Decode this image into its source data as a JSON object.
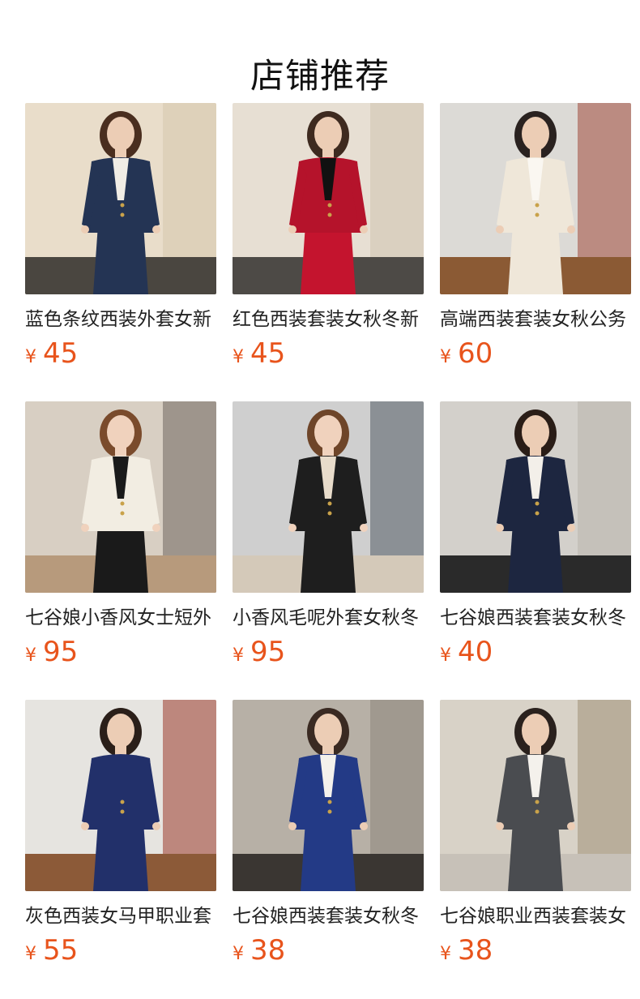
{
  "header": {
    "title": "店铺推荐"
  },
  "products": [
    {
      "name": "蓝色条纹西装外套女新",
      "currency": "¥",
      "price": "45",
      "colors": {
        "bg": "#e9ddca",
        "bgAccent": "#d6c6ad",
        "floor": "#4a4640",
        "jacket": "#243454",
        "inner": "#f1ede6",
        "bottom": "#243454",
        "hair": "#4a2e1f",
        "skin": "#eccdb5"
      }
    },
    {
      "name": "红色西装套装女秋冬新",
      "currency": "¥",
      "price": "45",
      "colors": {
        "bg": "#e7dfd3",
        "bgAccent": "#cfc3b0",
        "floor": "#4d4a46",
        "jacket": "#b5132b",
        "inner": "#111111",
        "bottom": "#c4142e",
        "hair": "#3e2a1f",
        "skin": "#eccdb5"
      }
    },
    {
      "name": "高端西装套装女秋公务",
      "currency": "¥",
      "price": "60",
      "colors": {
        "bg": "#dcdad6",
        "bgAccent": "#a04b3c",
        "floor": "#8b5a34",
        "jacket": "#efe7d9",
        "inner": "#faf7f1",
        "bottom": "#efe7d9",
        "hair": "#2a2220",
        "skin": "#eccdb5"
      }
    },
    {
      "name": "七谷娘小香风女士短外",
      "currency": "¥",
      "price": "95",
      "colors": {
        "bg": "#d8cfc3",
        "bgAccent": "#6f665e",
        "floor": "#b79a7c",
        "jacket": "#f2ede2",
        "inner": "#1a1a1a",
        "bottom": "#1a1a1a",
        "hair": "#7a4b2c",
        "skin": "#f0d2bd"
      }
    },
    {
      "name": "小香风毛呢外套女秋冬",
      "currency": "¥",
      "price": "95",
      "colors": {
        "bg": "#cfcfcf",
        "bgAccent": "#545c66",
        "floor": "#d4c9b9",
        "jacket": "#1e1e1e",
        "inner": "#e8dccb",
        "bottom": "#1e1e1e",
        "hair": "#6e4529",
        "skin": "#f0d2bd"
      }
    },
    {
      "name": "七谷娘西装套装女秋冬",
      "currency": "¥",
      "price": "40",
      "colors": {
        "bg": "#d3d0cb",
        "bgAccent": "#b9b4ad",
        "floor": "#2a2a2a",
        "jacket": "#1d2640",
        "inner": "#f3efe9",
        "bottom": "#1d2640",
        "hair": "#2a1d17",
        "skin": "#eccdb5"
      }
    },
    {
      "name": "灰色西装女马甲职业套",
      "currency": "¥",
      "price": "55",
      "colors": {
        "bg": "#e6e4e0",
        "bgAccent": "#9b3a2c",
        "floor": "#8c5a38",
        "jacket": "#22306a",
        "inner": "#22306a",
        "bottom": "#22306a",
        "hair": "#2b1f19",
        "skin": "#eccdb5"
      }
    },
    {
      "name": "七谷娘西装套装女秋冬",
      "currency": "¥",
      "price": "38",
      "colors": {
        "bg": "#b7b0a6",
        "bgAccent": "#8e867c",
        "floor": "#3a3632",
        "jacket": "#233a86",
        "inner": "#f4f1ec",
        "bottom": "#233a86",
        "hair": "#3a2a22",
        "skin": "#eccdb5"
      }
    },
    {
      "name": "七谷娘职业西装套装女",
      "currency": "¥",
      "price": "38",
      "colors": {
        "bg": "#d8d2c7",
        "bgAccent": "#a08f77",
        "floor": "#c7c1b8",
        "jacket": "#4a4c50",
        "inner": "#f4f1ec",
        "bottom": "#4a4c50",
        "hair": "#2a211d",
        "skin": "#eccdb5"
      }
    }
  ]
}
